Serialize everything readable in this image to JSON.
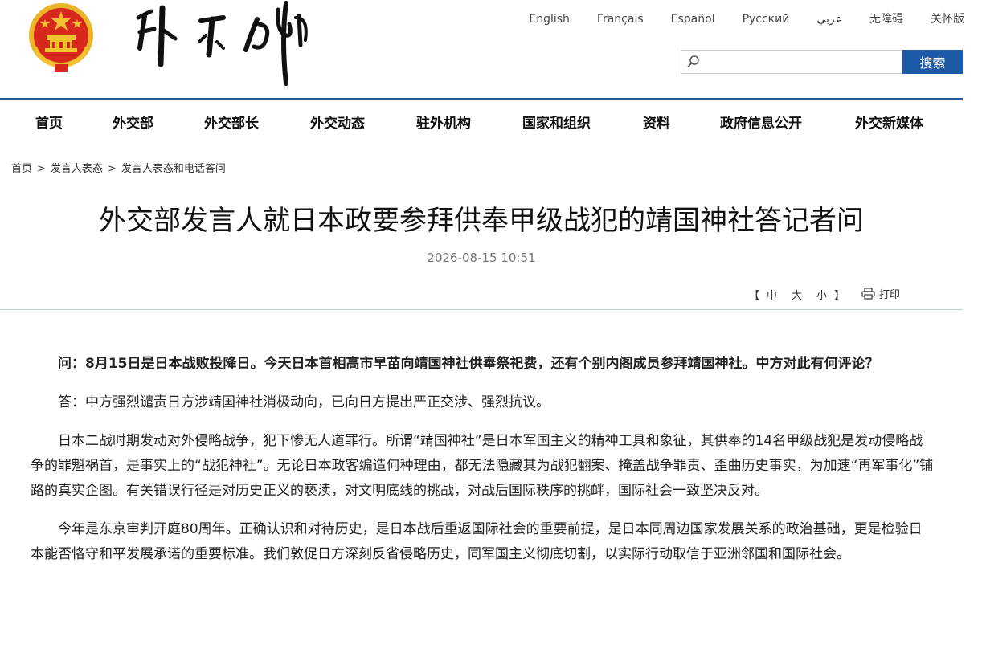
{
  "header": {
    "languages": [
      "English",
      "Français",
      "Español",
      "Русский",
      "عربي",
      "无障碍",
      "关怀版"
    ],
    "search": {
      "placeholder": "",
      "button_label": "搜索"
    }
  },
  "nav": {
    "items": [
      "首页",
      "外交部",
      "外交部长",
      "外交动态",
      "驻外机构",
      "国家和组织",
      "资料",
      "政府信息公开",
      "外交新媒体"
    ]
  },
  "breadcrumb": [
    "首页",
    "发言人表态",
    "发言人表态和电话答问"
  ],
  "article": {
    "title": "外交部发言人就日本政要参拜供奉甲级战犯的靖国神社答记者问",
    "date": "2026-08-15 10:51",
    "size_controls": {
      "open": "【",
      "large": "中",
      "medium": "大",
      "small": "小",
      "close": "】"
    },
    "print_label": "打印",
    "paragraphs": [
      "问：8月15日是日本战败投降日。今天日本首相高市早苗向靖国神社供奉祭祀费，还有个别内阁成员参拜靖国神社。中方对此有何评论？",
      "答：中方强烈谴责日方涉靖国神社消极动向，已向日方提出严正交涉、强烈抗议。",
      "日本二战时期发动对外侵略战争，犯下惨无人道罪行。所谓“靖国神社”是日本军国主义的精神工具和象征，其供奉的14名甲级战犯是发动侵略战争的罪魁祸首，是事实上的“战犯神社”。无论日本政客编造何种理由，都无法隐藏其为战犯翻案、掩盖战争罪责、歪曲历史事实，为加速“再军事化”铺路的真实企图。有关错误行径是对历史正义的亵渎，对文明底线的挑战，对战后国际秩序的挑衅，国际社会一致坚决反对。",
      "今年是东京审判开庭80周年。正确认识和对待历史，是日本战后重返国际社会的重要前提，是日本同周边国家发展关系的政治基础，更是检验日本能否恪守和平发展承诺的重要标准。我们敦促日方深刻反省侵略历史，同军国主义彻底切割，以实际行动取信于亚洲邻国和国际社会。"
    ]
  },
  "colors": {
    "accent": "#1c5aa7",
    "divider": "#b8d4e0",
    "emblem_red": "#d8281e",
    "emblem_gold": "#f2c230"
  },
  "icons": {
    "emblem": "national-emblem",
    "calligraphy": "ministry-calligraphy-logo",
    "search": "search-icon",
    "print": "printer-icon"
  }
}
